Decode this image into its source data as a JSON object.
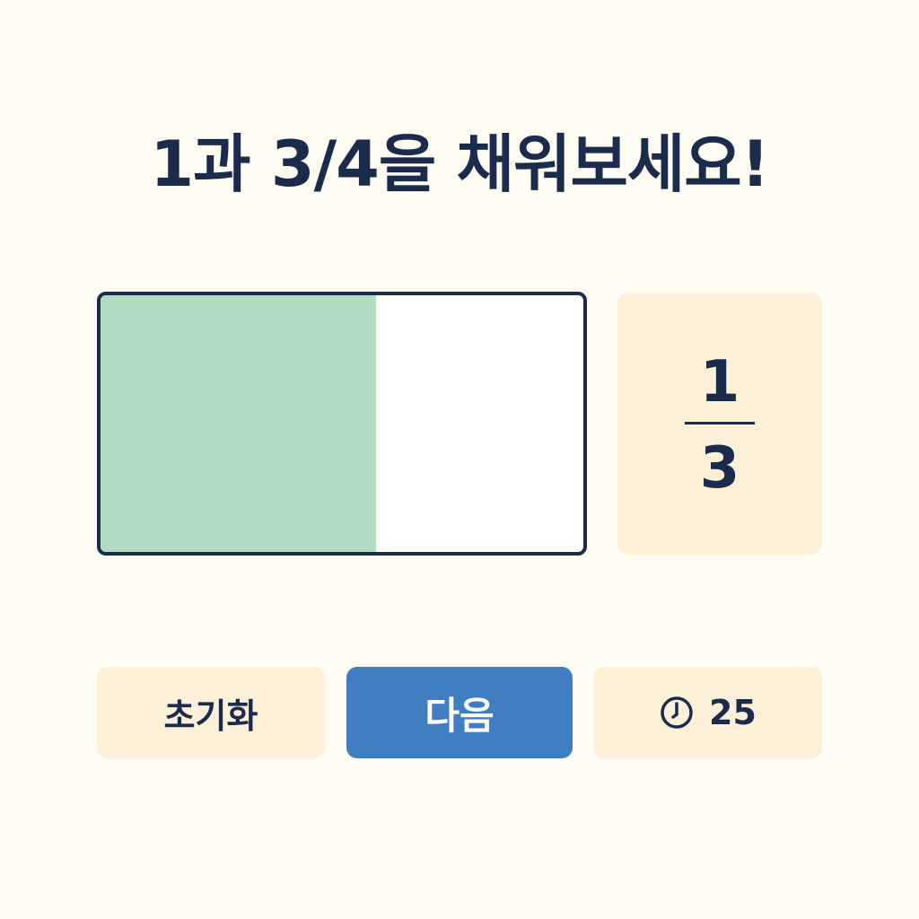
{
  "prompt": {
    "title": "1과 3/4을 채워보세요!"
  },
  "fraction_bar": {
    "filled_fraction": 0.57,
    "fill_color": "#b2dcc1"
  },
  "fraction_card": {
    "numerator": "1",
    "denominator": "3"
  },
  "controls": {
    "reset_label": "초기화",
    "next_label": "다음",
    "timer_value": "25",
    "timer_icon": "clock-icon"
  },
  "colors": {
    "background": "#fefcf3",
    "text": "#1b2b4b",
    "card": "#fdf0d8",
    "accent": "#3f7ec1"
  }
}
